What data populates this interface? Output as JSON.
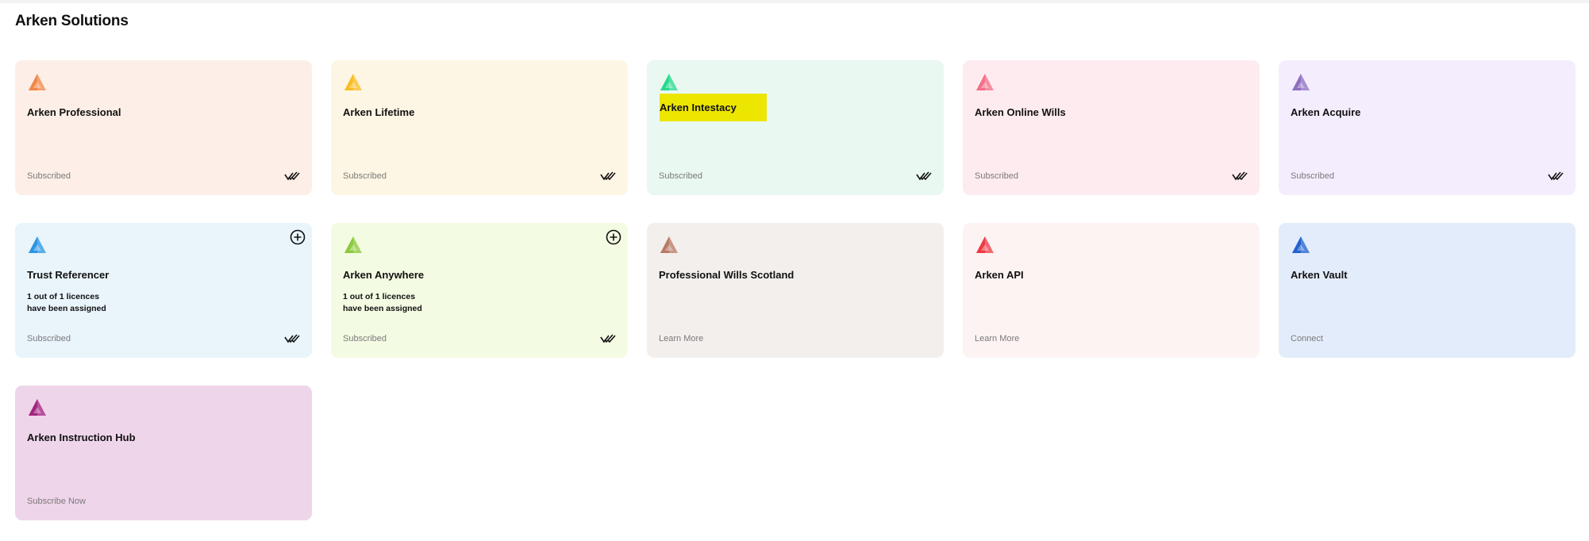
{
  "page": {
    "title": "Arken Solutions"
  },
  "cards": [
    {
      "name": "Arken Professional",
      "status": "Subscribed",
      "bg": "#fdefe7",
      "icon_color": "#f0884a",
      "icon": "arken-professional-logo"
    },
    {
      "name": "Arken Lifetime",
      "status": "Subscribed",
      "bg": "#fef6e4",
      "icon_color": "#f8bd24",
      "icon": "arken-lifetime-logo"
    },
    {
      "name": "Arken Intestacy",
      "status": "Subscribed",
      "bg": "#e9f8f1",
      "icon_color": "#26d98f",
      "icon": "arken-intestacy-logo",
      "highlight": "#ede600"
    },
    {
      "name": "Arken Online Wills",
      "status": "Subscribed",
      "bg": "#feebef",
      "icon_color": "#f2708a",
      "icon": "arken-online-wills-logo"
    },
    {
      "name": "Arken Acquire",
      "status": "Subscribed",
      "bg": "#f4edfe",
      "icon_color": "#8f6fc0",
      "icon": "arken-acquire-logo"
    },
    {
      "name": "Trust Referencer",
      "status": "Subscribed",
      "licences_line1": "1 out of 1 licences",
      "licences_line2": "have been assigned",
      "bg": "#e9f4fb",
      "icon_color": "#2b95e3",
      "icon": "trust-referencer-logo"
    },
    {
      "name": "Arken Anywhere",
      "status": "Subscribed",
      "licences_line1": "1 out of 1 licences",
      "licences_line2": "have been assigned",
      "bg": "#f3fbe2",
      "icon_color": "#8cc83c",
      "icon": "arken-anywhere-logo"
    },
    {
      "name": "Professional Wills Scotland",
      "status": "Learn More",
      "bg": "#f3efec",
      "icon_color": "#b87a66",
      "icon": "professional-wills-scotland-logo"
    },
    {
      "name": "Arken API",
      "status": "Learn More",
      "bg": "#fef3f3",
      "icon_color": "#ee3a44",
      "icon": "arken-api-logo"
    },
    {
      "name": "Arken Vault",
      "status": "Connect",
      "bg": "#e3ecfa",
      "icon_color": "#2361cf",
      "icon": "arken-vault-logo"
    },
    {
      "name": "Arken Instruction Hub",
      "status": "Subscribe Now",
      "bg": "#efd5ea",
      "icon_color": "#a3247f",
      "icon": "arken-instruction-hub-logo"
    }
  ]
}
